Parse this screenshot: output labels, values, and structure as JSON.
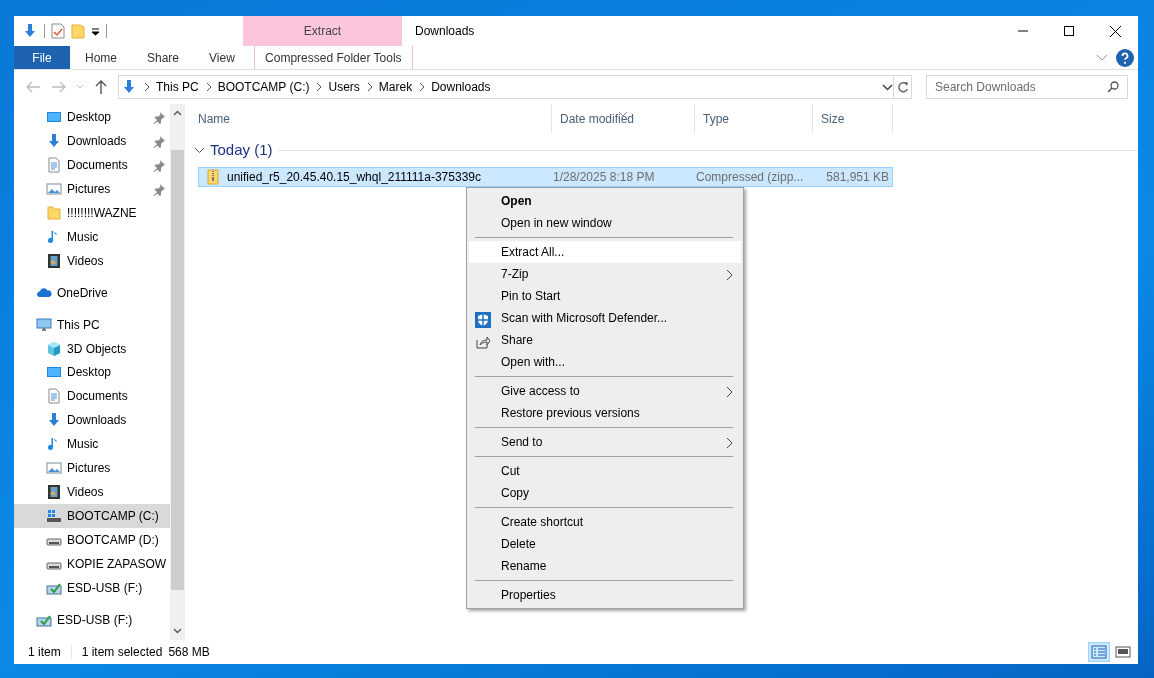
{
  "window": {
    "title": "Downloads"
  },
  "contextual_tab_group": {
    "label": "Extract"
  },
  "ribbon_tabs": [
    {
      "label": "File",
      "kind": "file"
    },
    {
      "label": "Home",
      "kind": "normal"
    },
    {
      "label": "Share",
      "kind": "normal"
    },
    {
      "label": "View",
      "kind": "normal"
    },
    {
      "label": "Compressed Folder Tools",
      "kind": "contextual"
    }
  ],
  "address_bar": {
    "segments": [
      "This PC",
      "BOOTCAMP (C:)",
      "Users",
      "Marek",
      "Downloads"
    ]
  },
  "search": {
    "placeholder": "Search Downloads"
  },
  "nav_pane": {
    "groups": [
      {
        "items": [
          {
            "label": "Desktop",
            "kind": "desktop",
            "pinned": true,
            "selected": false
          },
          {
            "label": "Downloads",
            "kind": "downloads",
            "pinned": true,
            "selected": false
          },
          {
            "label": "Documents",
            "kind": "documents",
            "pinned": true,
            "selected": false
          },
          {
            "label": "Pictures",
            "kind": "pictures",
            "pinned": true,
            "selected": false
          },
          {
            "label": "!!!!!!!!WAZNE",
            "kind": "folder",
            "pinned": false,
            "selected": false
          },
          {
            "label": "Music",
            "kind": "music",
            "pinned": false,
            "selected": false
          },
          {
            "label": "Videos",
            "kind": "videos",
            "pinned": false,
            "selected": false
          }
        ]
      },
      {
        "label": "OneDrive",
        "kind": "onedrive",
        "selected": false
      },
      {
        "label": "This PC",
        "kind": "pc",
        "selected": false,
        "children": [
          {
            "label": "3D Objects",
            "kind": "objects3d",
            "selected": false
          },
          {
            "label": "Desktop",
            "kind": "desktop",
            "selected": false
          },
          {
            "label": "Documents",
            "kind": "documents",
            "selected": false
          },
          {
            "label": "Downloads",
            "kind": "downloads",
            "selected": false
          },
          {
            "label": "Music",
            "kind": "music",
            "selected": false
          },
          {
            "label": "Pictures",
            "kind": "pictures",
            "selected": false
          },
          {
            "label": "Videos",
            "kind": "videos",
            "selected": false
          },
          {
            "label": "BOOTCAMP (C:)",
            "kind": "windrive",
            "selected": true
          },
          {
            "label": "BOOTCAMP (D:)",
            "kind": "drive",
            "selected": false
          },
          {
            "label": "KOPIE ZAPASOW",
            "kind": "drive",
            "selected": false
          },
          {
            "label": "ESD-USB (F:)",
            "kind": "usb",
            "selected": false
          }
        ]
      },
      {
        "label": "ESD-USB (F:)",
        "kind": "usb",
        "selected": false
      }
    ]
  },
  "file_list": {
    "columns": [
      {
        "label": "Name",
        "sorted": false
      },
      {
        "label": "Date modified",
        "sorted": true
      },
      {
        "label": "Type",
        "sorted": false
      },
      {
        "label": "Size",
        "sorted": false
      }
    ],
    "groups": [
      {
        "label": "Today (1)",
        "expanded": true,
        "rows": [
          {
            "name": "unified_r5_20.45.40.15_whql_211111a-375339c",
            "date": "1/28/2025 8:18 PM",
            "type": "Compressed (zipp...",
            "size": "581,951 KB",
            "selected": true
          }
        ]
      }
    ]
  },
  "context_menu": {
    "items": [
      {
        "kind": "command",
        "label": "Open",
        "default": true
      },
      {
        "kind": "command",
        "label": "Open in new window"
      },
      {
        "kind": "separator"
      },
      {
        "kind": "command",
        "label": "Extract All...",
        "selected": true
      },
      {
        "kind": "submenu",
        "label": "7-Zip"
      },
      {
        "kind": "command",
        "label": "Pin to Start"
      },
      {
        "kind": "scan",
        "label": "Scan with Microsoft Defender..."
      },
      {
        "kind": "share",
        "label": "Share"
      },
      {
        "kind": "command",
        "label": "Open with..."
      },
      {
        "kind": "separator"
      },
      {
        "kind": "submenu",
        "label": "Give access to"
      },
      {
        "kind": "command",
        "label": "Restore previous versions"
      },
      {
        "kind": "separator"
      },
      {
        "kind": "submenu",
        "label": "Send to"
      },
      {
        "kind": "separator"
      },
      {
        "kind": "command",
        "label": "Cut"
      },
      {
        "kind": "command",
        "label": "Copy"
      },
      {
        "kind": "separator"
      },
      {
        "kind": "command",
        "label": "Create shortcut"
      },
      {
        "kind": "command",
        "label": "Delete"
      },
      {
        "kind": "command",
        "label": "Rename"
      },
      {
        "kind": "separator"
      },
      {
        "kind": "command",
        "label": "Properties"
      }
    ]
  },
  "status_bar": {
    "item_count": "1 item",
    "selection": "1 item selected",
    "selection_size": "568 MB",
    "views": [
      {
        "kind": "details",
        "selected": true
      },
      {
        "kind": "large-icons",
        "selected": false
      }
    ]
  }
}
